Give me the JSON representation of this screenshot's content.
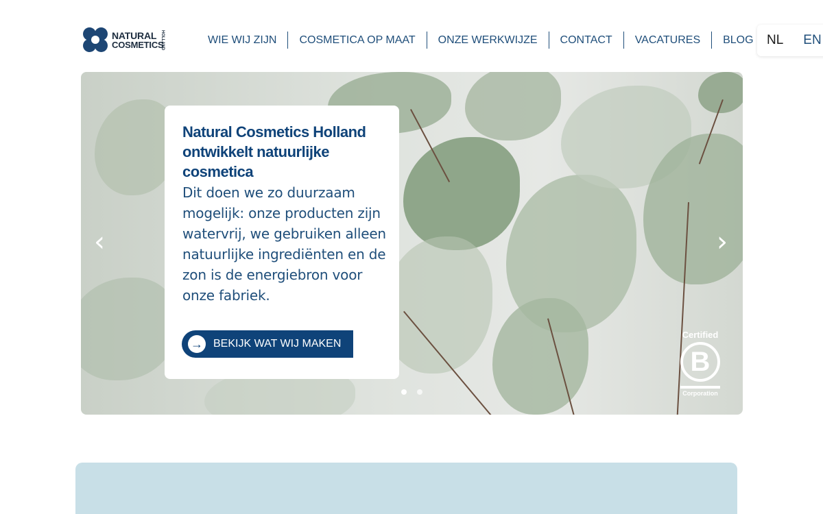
{
  "header": {
    "logo": {
      "line1": "NATURAL",
      "line2": "COSMETICS",
      "vertical": "HOLLAND"
    },
    "nav": [
      {
        "label": "WIE WIJ ZIJN"
      },
      {
        "label": "COSMETICA OP MAAT"
      },
      {
        "label": "ONZE WERKWIJZE"
      },
      {
        "label": "CONTACT"
      },
      {
        "label": "VACATURES"
      },
      {
        "label": "BLOG"
      }
    ],
    "languages": {
      "nl": "NL",
      "en": "EN"
    }
  },
  "hero": {
    "title": "Natural Cosmetics Holland ontwikkelt natuurlijke cosmetica",
    "body": "Dit doen we zo duurzaam mogelijk: onze producten zijn watervrij, we gebruiken alleen natuurlijke ingrediënten en de zon is de energiebron voor onze fabriek.",
    "cta_label": "BEKIJK WAT WIJ MAKEN",
    "prev_arrow": "‹",
    "next_arrow": "›",
    "slides": 2,
    "active_slide": 1,
    "bcorp": {
      "top": "Certified",
      "mark": "B",
      "bottom": "Corporation"
    }
  },
  "colors": {
    "primary": "#0f4379",
    "nav_text": "#1f4e7a",
    "panel": "#c8dfe7"
  },
  "icons": {
    "cta": "arrow-right-circle-icon",
    "prev": "chevron-left-icon",
    "next": "chevron-right-icon"
  }
}
